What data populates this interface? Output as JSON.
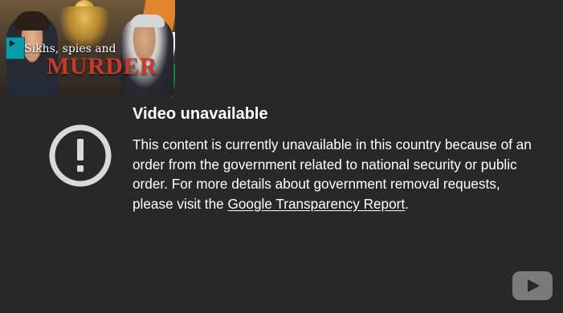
{
  "thumbnail": {
    "headline_top": "Sikhs, spies and",
    "headline_main": "MURDER",
    "badge_text": "",
    "accent_color": "#c7392d"
  },
  "error": {
    "title": "Video unavailable",
    "message_lead": "This content is currently unavailable in this country because of an order from the government related to national security or public order. For more details about government removal requests, please visit the ",
    "link_text": "Google Transparency Report",
    "message_tail": ".",
    "icon": "exclamation-circle-icon"
  },
  "watermark": {
    "icon": "youtube-logo-icon"
  }
}
